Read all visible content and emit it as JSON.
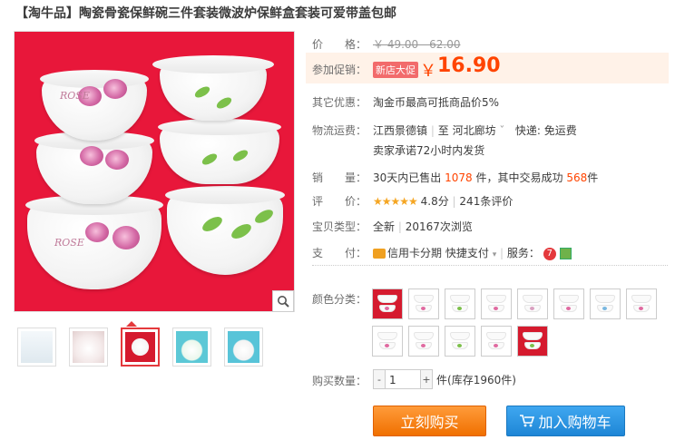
{
  "product": {
    "title": "【淘牛品】陶瓷骨瓷保鲜碗三件套装微波炉保鲜盒套装可爱带盖包邮",
    "image_text": "ROSE"
  },
  "price": {
    "label": "价　　格：",
    "original": "￥ 49.00 - 62.00",
    "promo_label": "参加促销：",
    "promo_tag": "新店大促",
    "currency": "￥",
    "current": "16.90"
  },
  "rows": {
    "offers_label": "其它优惠：",
    "offers_value": "淘金币最高可抵商品价5%",
    "shipping_label": "物流运费：",
    "ship_from": "江西景德镇",
    "ship_to_prefix": "至",
    "ship_to": "河北廊坊",
    "ship_dropdown": "ˇ",
    "ship_fee": "快递: 免运费",
    "ship_promise": "卖家承诺72小时内发货",
    "sales_label": "销　　量：",
    "sales_prefix": "30天内已售出",
    "sales_count": "1078",
    "sales_mid": "件，其中交易成功",
    "sales_success": "568",
    "sales_unit": "件",
    "rating_label": "评　　价：",
    "rating_stars": "★★★★★",
    "rating_score": "4.8分",
    "rating_sep": "|",
    "rating_count": "241条评价",
    "type_label": "宝贝类型：",
    "type_value": "全新",
    "type_sep": "|",
    "views": "20167次浏览",
    "pay_label": "支　　付：",
    "pay_credit": "信用卡分期",
    "pay_quick": "快捷支付",
    "pay_sep": "|",
    "service_label": "服务：",
    "service_seven": "7"
  },
  "colors": {
    "label": "颜色分类：",
    "count": 13
  },
  "quantity": {
    "label": "购买数量：",
    "minus": "-",
    "value": "1",
    "plus": "+",
    "unit": "件",
    "stock": "(库存1960件)"
  },
  "actions": {
    "buy": "立刻购买",
    "cart": "加入购物车"
  },
  "style": {
    "accent": "#ff4400",
    "buy_color": "#f07000",
    "cart_color": "#1e86d6",
    "image_bg": "#e8173a"
  }
}
